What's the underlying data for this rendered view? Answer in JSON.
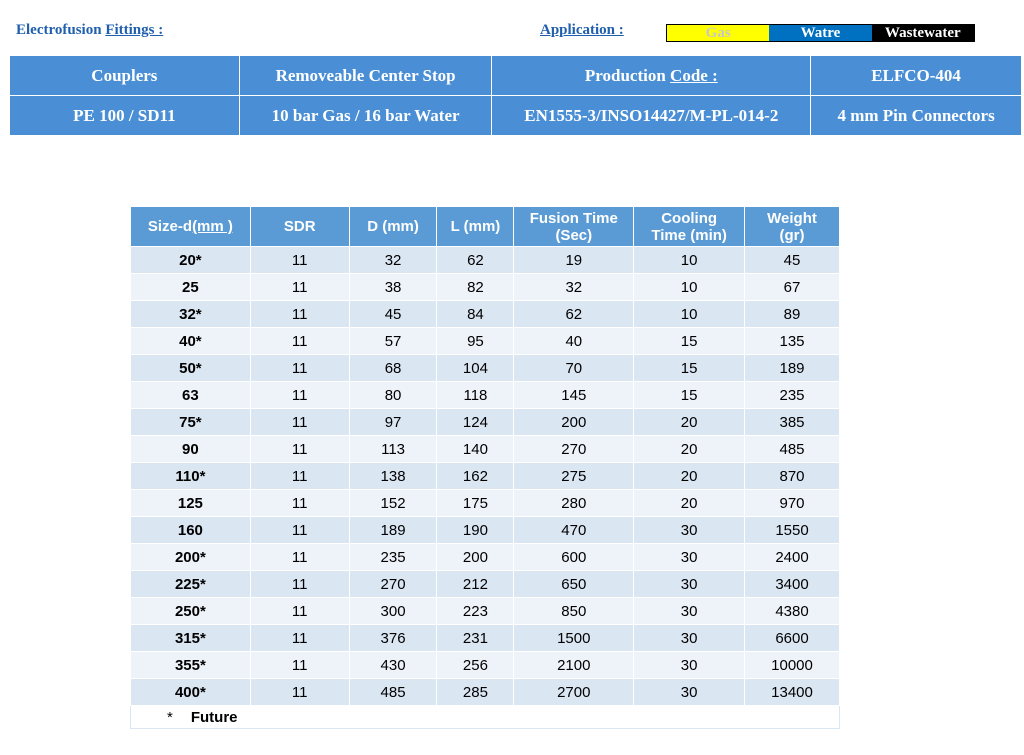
{
  "header": {
    "title_prefix": "Electrofusion ",
    "title_link": "Fittings :",
    "application_label": "Application :",
    "applications": [
      "Gas",
      "Watre",
      "Wastewater"
    ]
  },
  "info": {
    "row1": [
      "Couplers",
      "Removeable Center Stop",
      "Production ",
      "Code :",
      "ELFCO-404"
    ],
    "row2": [
      "PE 100 / SD11",
      "10 bar Gas / 16 bar Water",
      "EN1555-3/INSO14427/M-PL-014-2",
      "4 mm Pin Connectors"
    ]
  },
  "table": {
    "headers": {
      "size_prefix": "Size-d",
      "size_unit": "(mm )",
      "sdr": "SDR",
      "d": "D (mm)",
      "l": "L (mm)",
      "fusion_1": "Fusion Time",
      "fusion_2": "(Sec)",
      "cooling_1": "Cooling",
      "cooling_2": "Time (min)",
      "weight_1": "Weight",
      "weight_2": "(gr)"
    },
    "rows": [
      [
        "20*",
        "11",
        "32",
        "62",
        "19",
        "10",
        "45"
      ],
      [
        "25",
        "11",
        "38",
        "82",
        "32",
        "10",
        "67"
      ],
      [
        "32*",
        "11",
        "45",
        "84",
        "62",
        "10",
        "89"
      ],
      [
        "40*",
        "11",
        "57",
        "95",
        "40",
        "15",
        "135"
      ],
      [
        "50*",
        "11",
        "68",
        "104",
        "70",
        "15",
        "189"
      ],
      [
        "63",
        "11",
        "80",
        "118",
        "145",
        "15",
        "235"
      ],
      [
        "75*",
        "11",
        "97",
        "124",
        "200",
        "20",
        "385"
      ],
      [
        "90",
        "11",
        "113",
        "140",
        "270",
        "20",
        "485"
      ],
      [
        "110*",
        "11",
        "138",
        "162",
        "275",
        "20",
        "870"
      ],
      [
        "125",
        "11",
        "152",
        "175",
        "280",
        "20",
        "970"
      ],
      [
        "160",
        "11",
        "189",
        "190",
        "470",
        "30",
        "1550"
      ],
      [
        "200*",
        "11",
        "235",
        "200",
        "600",
        "30",
        "2400"
      ],
      [
        "225*",
        "11",
        "270",
        "212",
        "650",
        "30",
        "3400"
      ],
      [
        "250*",
        "11",
        "300",
        "223",
        "850",
        "30",
        "4380"
      ],
      [
        "315*",
        "11",
        "376",
        "231",
        "1500",
        "30",
        "6600"
      ],
      [
        "355*",
        "11",
        "430",
        "256",
        "2100",
        "30",
        "10000"
      ],
      [
        "400*",
        "11",
        "485",
        "285",
        "2700",
        "30",
        "13400"
      ]
    ],
    "footnote_symbol": "*",
    "footnote_text": "Future"
  },
  "colors": {
    "title_blue": "#1f5fad",
    "header_blue": "#4a8fd6",
    "table_header_blue": "#5b9bd5",
    "row_light": "#dbe6f3",
    "row_lighter": "#eef3fa",
    "gas_yellow": "#ffff00",
    "water_blue": "#0070c0",
    "wastewater_black": "#000000"
  }
}
